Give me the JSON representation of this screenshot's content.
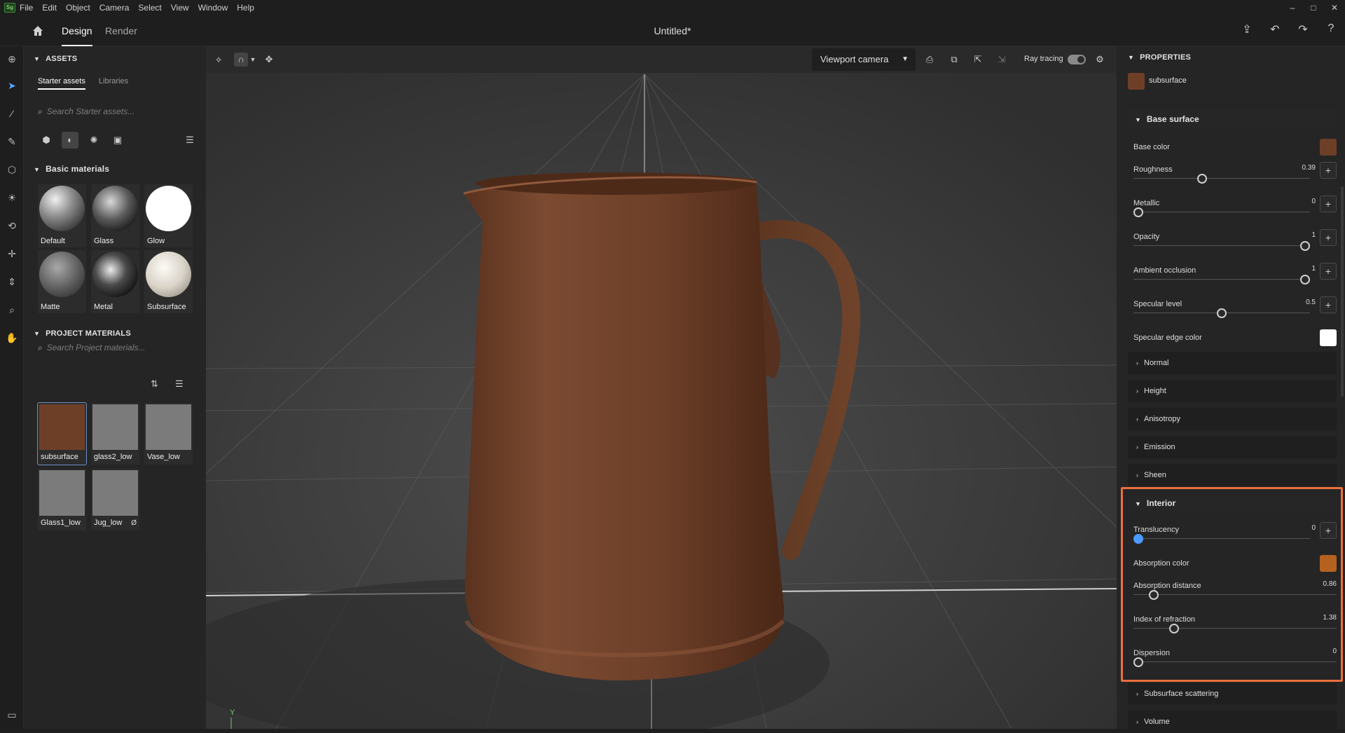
{
  "menu": {
    "logo": "Sg",
    "items": [
      "File",
      "Edit",
      "Object",
      "Camera",
      "Select",
      "View",
      "Window",
      "Help"
    ],
    "window_controls": [
      "–",
      "□",
      "✕"
    ]
  },
  "header": {
    "tabs": [
      "Design",
      "Render"
    ],
    "active_tab": "Design",
    "title": "Untitled*"
  },
  "assets": {
    "heading": "ASSETS",
    "subtabs": [
      "Starter assets",
      "Libraries"
    ],
    "search_placeholder": "Search Starter assets...",
    "basic_heading": "Basic materials",
    "materials": [
      "Default",
      "Glass",
      "Glow",
      "Matte",
      "Metal",
      "Subsurface"
    ]
  },
  "project": {
    "heading": "PROJECT MATERIALS",
    "search_placeholder": "Search Project materials...",
    "materials": [
      "subsurface",
      "glass2_low",
      "Vase_low",
      "Glass1_low",
      "Jug_low"
    ],
    "unlinked_icon_label": "Ø"
  },
  "viewport": {
    "camera": "Viewport camera",
    "ray_tracing_label": "Ray tracing",
    "ray_tracing_on": true,
    "axis_label": "Y"
  },
  "properties": {
    "heading": "PROPERTIES",
    "material_name": "subsurface",
    "material_color": "#6e3f27",
    "base_surface": {
      "title": "Base surface",
      "base_color_label": "Base color",
      "base_color": "#6e3f27",
      "roughness_label": "Roughness",
      "roughness": "0.39",
      "metallic_label": "Metallic",
      "metallic": "0",
      "opacity_label": "Opacity",
      "opacity": "1",
      "ao_label": "Ambient occlusion",
      "ao": "1",
      "specular_label": "Specular level",
      "specular": "0.5",
      "spec_edge_label": "Specular edge color",
      "spec_edge_color": "#ffffff"
    },
    "collapsed": [
      "Normal",
      "Height",
      "Anisotropy",
      "Emission",
      "Sheen"
    ],
    "interior": {
      "title": "Interior",
      "translucency_label": "Translucency",
      "translucency": "0",
      "absorption_color_label": "Absorption color",
      "absorption_color": "#b5611f",
      "absorption_distance_label": "Absorption distance",
      "absorption_distance": "0.86",
      "ior_label": "Index of refraction",
      "ior": "1.38",
      "dispersion_label": "Dispersion",
      "dispersion": "0"
    },
    "after": [
      "Subsurface scattering",
      "Volume"
    ]
  }
}
